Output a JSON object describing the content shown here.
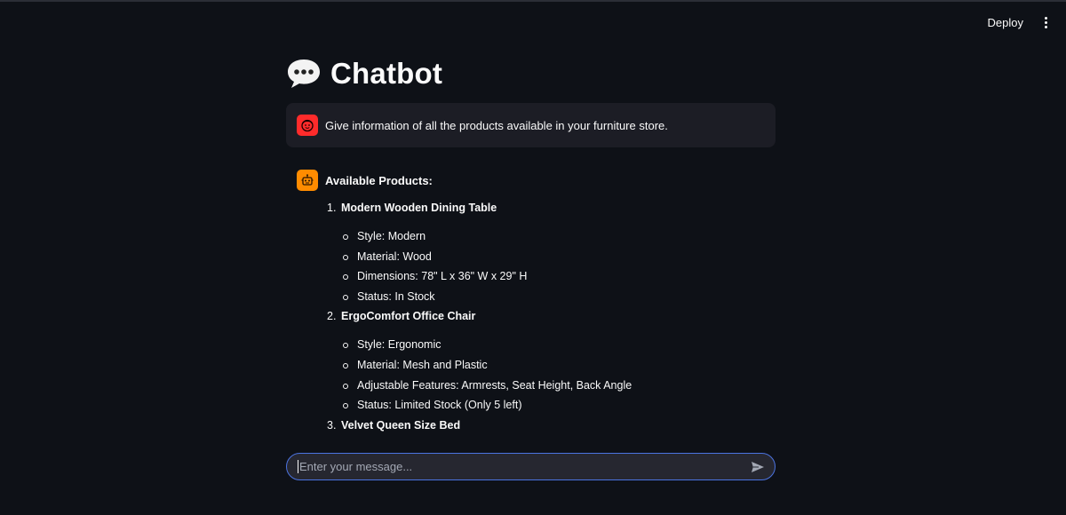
{
  "header": {
    "deploy_label": "Deploy",
    "menu_icon": "more-vertical-icon"
  },
  "page": {
    "title": "Chatbot",
    "title_icon": "speech-bubble-icon"
  },
  "messages": {
    "user": {
      "avatar_icon": "user-face-icon",
      "avatar_color": "#ff2b2b",
      "text": "Give information of all the products available in your furniture store."
    },
    "assistant": {
      "avatar_icon": "robot-icon",
      "avatar_color": "#ff8c00",
      "heading": "Available Products:",
      "products": [
        {
          "number": "1.",
          "name": "Modern Wooden Dining Table",
          "specs": [
            "Style: Modern",
            "Material: Wood",
            "Dimensions: 78\" L x 36\" W x 29\" H",
            "Status: In Stock"
          ]
        },
        {
          "number": "2.",
          "name": "ErgoComfort Office Chair",
          "specs": [
            "Style: Ergonomic",
            "Material: Mesh and Plastic",
            "Adjustable Features: Armrests, Seat Height, Back Angle",
            "Status: Limited Stock (Only 5 left)"
          ]
        },
        {
          "number": "3.",
          "name": "Velvet Queen Size Bed",
          "specs": []
        }
      ]
    }
  },
  "chat_input": {
    "placeholder": "Enter your message...",
    "value": "",
    "send_icon": "send-icon"
  },
  "colors": {
    "background": "#0e1117",
    "user_bubble": "#1c1d25",
    "input_border": "#4b73e0",
    "input_background": "#262730"
  }
}
